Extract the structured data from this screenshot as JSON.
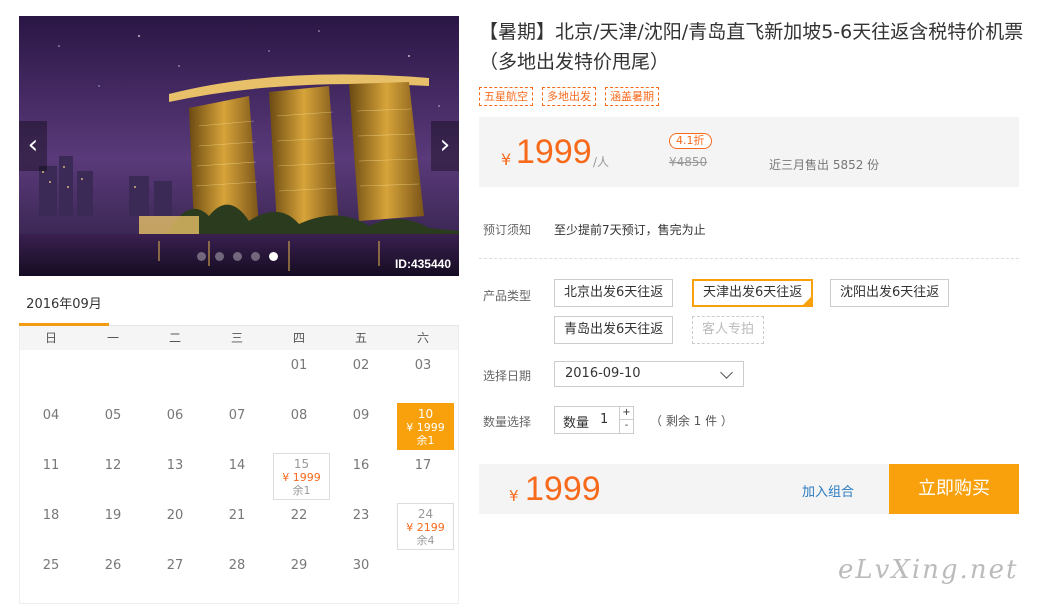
{
  "gallery": {
    "image_id": "ID:435440",
    "prev_icon": "chevron-left-icon",
    "next_icon": "chevron-right-icon",
    "dot_count": 5,
    "active_dot": 4,
    "prev_glyph": "‹",
    "next_glyph": "›"
  },
  "calendar": {
    "month_tab": "2016年09月",
    "weekdays": [
      "日",
      "一",
      "二",
      "三",
      "四",
      "五",
      "六"
    ],
    "weeks": [
      [
        "",
        "",
        "",
        "",
        "01",
        "02",
        "03"
      ],
      [
        "04",
        "05",
        "06",
        "07",
        "08",
        "09",
        "10"
      ],
      [
        "11",
        "12",
        "13",
        "14",
        "15",
        "16",
        "17"
      ],
      [
        "18",
        "19",
        "20",
        "21",
        "22",
        "23",
        "24"
      ],
      [
        "25",
        "26",
        "27",
        "28",
        "29",
        "30",
        ""
      ]
    ],
    "available": {
      "10": {
        "price": "¥ 1999",
        "left": "余1",
        "selected": true
      },
      "15": {
        "price": "¥ 1999",
        "left": "余1",
        "selected": false
      },
      "24": {
        "price": "¥ 2199",
        "left": "余4",
        "selected": false
      }
    }
  },
  "product": {
    "title": "【暑期】北京/天津/沈阳/青岛直飞新加坡5-6天往返含税特价机票（多地出发特价甩尾）",
    "tags": [
      "五星航空",
      "多地出发",
      "涵盖暑期"
    ]
  },
  "price_box": {
    "currency": "¥",
    "price": "1999",
    "unit": "/人",
    "discount": "4.1折",
    "original": "¥4850",
    "sold": "近三月售出 5852 份"
  },
  "notice": {
    "label": "预订须知",
    "text": "至少提前7天预订，售完为止"
  },
  "product_type": {
    "label": "产品类型",
    "options": [
      "北京出发6天往返",
      "天津出发6天往返",
      "沈阳出发6天往返",
      "青岛出发6天往返",
      "客人专拍"
    ],
    "selected": 1,
    "disabled": [
      4
    ]
  },
  "date": {
    "label": "选择日期",
    "value": "2016-09-10",
    "icon": "chevron-down-icon"
  },
  "quantity": {
    "label": "数量选择",
    "field_label": "数量",
    "value": "1",
    "plus": "+",
    "minus": "-",
    "remain": "（ 剩余 1 件 ）"
  },
  "buy_bar": {
    "currency": "¥",
    "price": "1999",
    "add_label": "加入组合",
    "buy_label": "立即购买"
  },
  "watermark": "eLvXing.net",
  "colors": {
    "accent": "#f8a10c",
    "price": "#f76a1c",
    "link": "#2a7bc1"
  }
}
